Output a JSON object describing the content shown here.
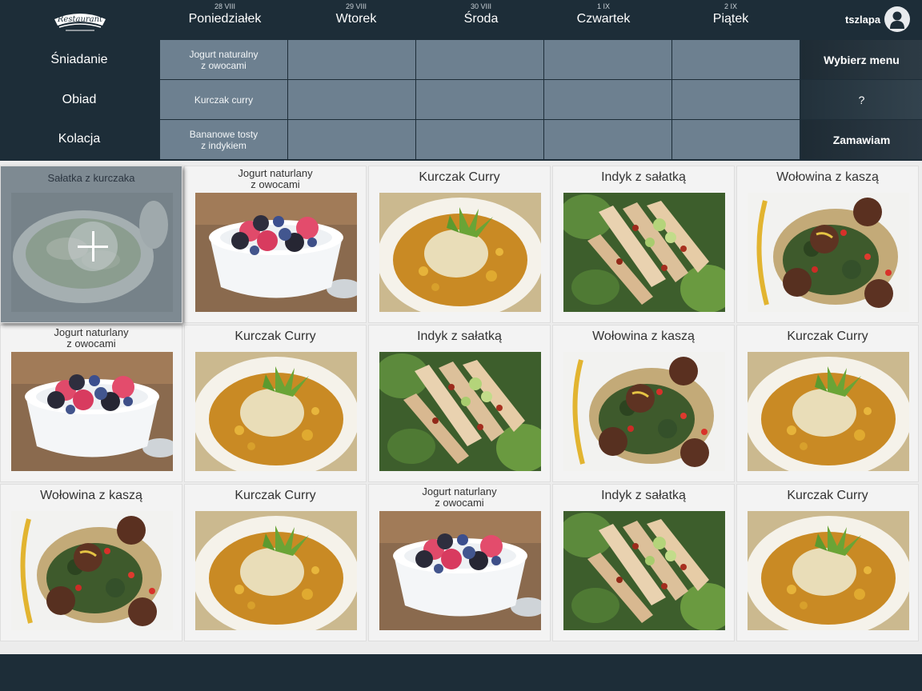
{
  "logo": {
    "text": "Restaurant",
    "icon": "restaurant-logo"
  },
  "days": [
    {
      "date": "28 VIII",
      "name": "Poniedziałek"
    },
    {
      "date": "29 VIII",
      "name": "Wtorek"
    },
    {
      "date": "30 VIII",
      "name": "Środa"
    },
    {
      "date": "1 IX",
      "name": "Czwartek"
    },
    {
      "date": "2 IX",
      "name": "Piątek"
    }
  ],
  "user": {
    "name": "tszlapa",
    "icon": "user-avatar-icon"
  },
  "meals": [
    {
      "label": "Śniadanie",
      "cells": [
        "Jogurt naturalny\nz owocami",
        "",
        "",
        "",
        ""
      ]
    },
    {
      "label": "Obiad",
      "cells": [
        "Kurczak curry",
        "",
        "",
        "",
        ""
      ]
    },
    {
      "label": "Kolacja",
      "cells": [
        "Bananowe tosty\nz indykiem",
        "",
        "",
        "",
        ""
      ]
    }
  ],
  "buttons": {
    "choose_menu": "Wybierz menu",
    "help": "?",
    "order": "Zamawiam"
  },
  "selected_tile": {
    "title": "Sałatka z kurczaka",
    "icon": "plus-icon"
  },
  "tiles": [
    {
      "title": "Jogurt naturlany\nz owocami",
      "kind": "yogurt"
    },
    {
      "title": "Kurczak Curry",
      "kind": "curry"
    },
    {
      "title": "Indyk z sałatką",
      "kind": "turkey"
    },
    {
      "title": "Wołowina z kaszą",
      "kind": "beef"
    },
    {
      "title": "Jogurt naturlany\nz owocami",
      "kind": "yogurt"
    },
    {
      "title": "Kurczak Curry",
      "kind": "curry"
    },
    {
      "title": "Indyk z sałatką",
      "kind": "turkey"
    },
    {
      "title": "Wołowina z kaszą",
      "kind": "beef"
    },
    {
      "title": "Kurczak Curry",
      "kind": "curry"
    },
    {
      "title": "Wołowina z kaszą",
      "kind": "beef"
    },
    {
      "title": "Kurczak Curry",
      "kind": "curry"
    },
    {
      "title": "Jogurt naturlany\nz owocami",
      "kind": "yogurt"
    },
    {
      "title": "Indyk z sałatką",
      "kind": "turkey"
    },
    {
      "title": "Kurczak Curry",
      "kind": "curry"
    }
  ],
  "colors": {
    "header_bg": "#1d2d38",
    "cell_bg": "#6d8090",
    "tile_bg": "#f3f3f3"
  }
}
